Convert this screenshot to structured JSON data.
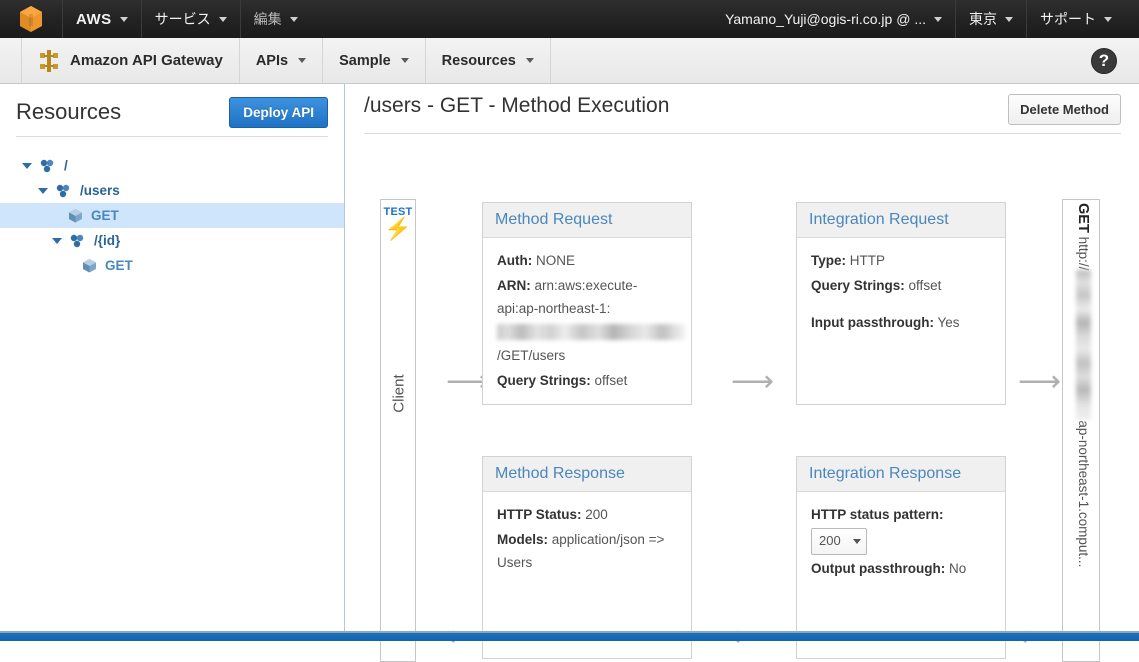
{
  "topnav": {
    "logo_icon": "aws-cube-logo",
    "items": [
      {
        "label": "AWS",
        "has_caret": true
      },
      {
        "label": "サービス",
        "has_caret": true
      },
      {
        "label": "編集",
        "has_caret": true
      }
    ],
    "right_items": [
      {
        "label": "Yamano_Yuji@ogis-ri.co.jp @ ...",
        "has_caret": true
      },
      {
        "label": "東京",
        "has_caret": true
      },
      {
        "label": "サポート",
        "has_caret": true
      }
    ]
  },
  "servicebar": {
    "brand": "Amazon API Gateway",
    "brand_icon": "api-gateway-icon",
    "items": [
      {
        "label": "APIs",
        "has_caret": true
      },
      {
        "label": "Sample",
        "has_caret": true
      },
      {
        "label": "Resources",
        "has_caret": true
      }
    ],
    "help_icon": "question-mark-icon",
    "help_label": "?"
  },
  "sidebar": {
    "title": "Resources",
    "deploy_label": "Deploy API",
    "tree": [
      {
        "label": "/",
        "type": "resource",
        "depth": 0,
        "expanded": true,
        "selected": false
      },
      {
        "label": "/users",
        "type": "resource",
        "depth": 1,
        "expanded": true,
        "selected": false
      },
      {
        "label": "GET",
        "type": "method",
        "depth": 2,
        "expanded": null,
        "selected": true
      },
      {
        "label": "/{id}",
        "type": "resource",
        "depth": 1,
        "expanded": true,
        "selected": false
      },
      {
        "label": "GET",
        "type": "method",
        "depth": 2,
        "expanded": null,
        "selected": false
      }
    ]
  },
  "main": {
    "title": "/users - GET - Method Execution",
    "delete_label": "Delete Method"
  },
  "diagram": {
    "client": {
      "test_label": "TEST",
      "bolt_icon": "lightning-bolt-icon",
      "rot_label": "Client"
    },
    "method_request": {
      "title": "Method Request",
      "rows": [
        {
          "key": "Auth:",
          "value": "NONE"
        },
        {
          "key": "ARN:",
          "value": "arn:aws:execute-api:ap-northeast-1:",
          "redacted": true,
          "value_suffix": "/GET/users"
        },
        {
          "key": "Query Strings:",
          "value": "offset"
        }
      ]
    },
    "integration_request": {
      "title": "Integration Request",
      "rows": [
        {
          "key": "Type:",
          "value": "HTTP"
        },
        {
          "key": "Query Strings:",
          "value": "offset"
        },
        {
          "key": "Input passthrough:",
          "value": "Yes"
        }
      ]
    },
    "method_response": {
      "title": "Method Response",
      "rows": [
        {
          "key": "HTTP Status:",
          "value": "200"
        },
        {
          "key": "Models:",
          "value": "application/json => Users"
        }
      ]
    },
    "integration_response": {
      "title": "Integration Response",
      "rows": [
        {
          "key": "HTTP status pattern:",
          "value": "200",
          "is_select": true
        },
        {
          "key": "Output passthrough:",
          "value": "No"
        }
      ]
    },
    "endpoint": {
      "method": "GET",
      "url_prefix": "http://",
      "url_suffix": "ap-northeast-1.comput...",
      "redacted": true
    },
    "arrow_right_glyph": "⟶",
    "arrow_left_glyph": "⟵"
  },
  "colors": {
    "accent_blue": "#1f72c4",
    "link_blue": "#2a6496",
    "header_blue": "#4a87bd",
    "topbar_dark": "#232323",
    "bottom_bar": "#1464ad"
  }
}
